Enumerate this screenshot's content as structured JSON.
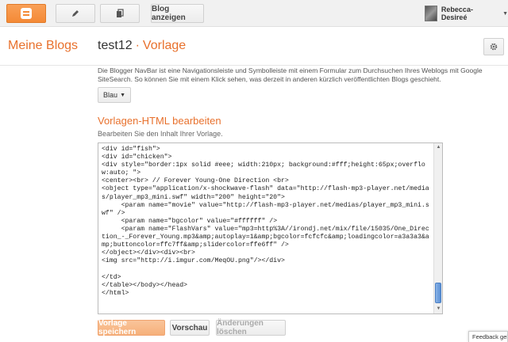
{
  "topbar": {
    "view_blog_label": "Blog anzeigen",
    "user_name": "Rebecca-Desireé"
  },
  "header": {
    "brand": "Meine Blogs",
    "blog_name": "test12",
    "separator": "·",
    "page_name": "Vorlage"
  },
  "navbar_section": {
    "description": "Die Blogger NavBar ist eine Navigationsleiste und Symbolleiste mit einem Formular zum Durchsuchen Ihres Weblogs mit Google SiteSearch. So können Sie mit einem Klick sehen, was derzeit in anderen kürzlich veröffentlichten Blogs geschieht.",
    "color_selected": "Blau"
  },
  "template_section": {
    "title": "Vorlagen-HTML bearbeiten",
    "subtitle": "Bearbeiten Sie den Inhalt Ihrer Vorlage.",
    "code": "<div id=\"fish\">\n<div id=\"chicken\">\n<div style=\"border:1px solid #eee; width:210px; background:#fff;height:65px;overflow:auto; \">\n<center><br> // Forever Young-One Direction <br>\n<object type=\"application/x-shockwave-flash\" data=\"http://flash-mp3-player.net/medias/player_mp3_mini.swf\" width=\"200\" height=\"20\">\n     <param name=\"movie\" value=\"http://flash-mp3-player.net/medias/player_mp3_mini.swf\" />\n     <param name=\"bgcolor\" value=\"#ffffff\" />\n     <param name=\"FlashVars\" value=\"mp3=http%3A//irondj.net/mix/file/15035/One_Direction_-_Forever_Young.mp3&amp;autoplay=1&amp;bgcolor=fcfcfc&amp;loadingcolor=a3a3a3&amp;buttoncolor=ffc7ff&amp;slidercolor=ffe6ff\" />\n</object></div><div><br>\n<img src=\"http://i.imgur.com/MeqOU.png\"/></div>\n\n</td>\n</table></body></head>\n</html>",
    "save_label": "Vorlage speichern",
    "preview_label": "Vorschau",
    "clear_label": "Änderungen löschen"
  },
  "feedback_label": "Feedback geb",
  "colors": {
    "accent": "#e8712d",
    "topbar_bg": "#f1f1f1"
  },
  "icons": {
    "blogger": "blogger-icon",
    "pencil": "pencil-icon",
    "pages": "pages-icon",
    "gear": "gear-icon",
    "dropdown": "chevron-down-icon"
  }
}
